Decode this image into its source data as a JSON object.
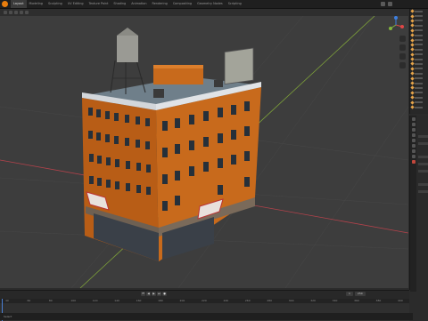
{
  "app": {
    "tabs": [
      "Layout",
      "Modeling",
      "Sculpting",
      "UV Editing",
      "Texture Paint",
      "Shading",
      "Animation",
      "Rendering",
      "Compositing",
      "Geometry Nodes",
      "Scripting"
    ],
    "active_tab_index": 0,
    "accent_color": "#e87d0d"
  },
  "viewport": {
    "background": "#3d3d3d",
    "x_axis_color": "#b4424b",
    "y_axis_color": "#7fa33a",
    "gizmo_colors": [
      "#e04646",
      "#82b53c",
      "#3d7fe0"
    ]
  },
  "timeline": {
    "play_controls": [
      "⏮",
      "◀",
      "▶",
      "⏭",
      "●"
    ],
    "frame_fields": [
      "1",
      "250"
    ],
    "ruler": [
      "40",
      "60",
      "80",
      "100",
      "120",
      "140",
      "160",
      "180",
      "200",
      "220",
      "240",
      "260",
      "280",
      "300",
      "320",
      "340",
      "360",
      "380",
      "400"
    ]
  },
  "status": {
    "text": "Select"
  },
  "icons": {
    "logo": "blender-logo-icon",
    "gizmo": "navigation-gizmo-icon",
    "outliner_item": "object-triangle-icon"
  }
}
